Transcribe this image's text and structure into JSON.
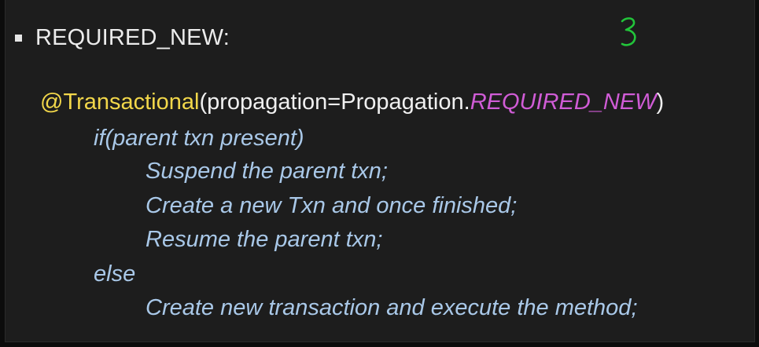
{
  "slide": {
    "heading": "REQUIRED_NEW:",
    "code": {
      "annotation": "@Transactional",
      "args_prefix": "(propagation=Propagation.",
      "enum_value": "REQUIRED_NEW",
      "args_suffix": ")",
      "if_line": "if(parent txn present)",
      "suspend_line": "Suspend the parent txn;",
      "create_line": "Create a new Txn and once finished;",
      "resume_line": "Resume the parent txn;",
      "else_line": "else",
      "else_create_line": "Create new transaction and execute the method;"
    },
    "handwritten_note": "3"
  },
  "colors": {
    "background": "#1d1d1d",
    "heading": "#ececec",
    "annotation": "#f2d74a",
    "enum": "#d05cd6",
    "pseudo_code": "#a9c8e8",
    "handwriting": "#22c43a"
  }
}
